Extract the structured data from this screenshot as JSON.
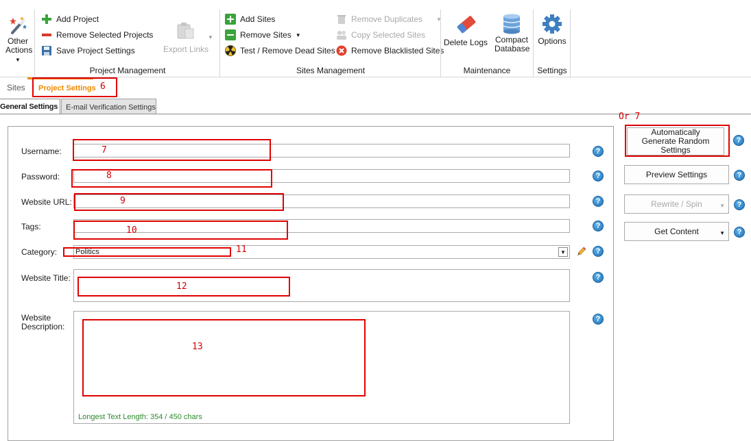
{
  "ribbon": {
    "other_actions": "Other Actions",
    "project_management": {
      "group_label": "Project Management",
      "add_project": "Add Project",
      "remove_selected_projects": "Remove Selected Projects",
      "save_project_settings": "Save Project Settings",
      "export_links": "Export Links"
    },
    "sites_management": {
      "group_label": "Sites Management",
      "add_sites": "Add Sites",
      "remove_sites": "Remove Sites",
      "test_remove_dead_sites": "Test / Remove Dead Sites",
      "remove_duplicates": "Remove Duplicates",
      "copy_selected_sites": "Copy Selected Sites",
      "remove_blacklisted_sites": "Remove Blacklisted Sites"
    },
    "maintenance": {
      "group_label": "Maintenance",
      "delete_logs": "Delete Logs",
      "compact_database": "Compact Database"
    },
    "settings": {
      "group_label": "Settings",
      "options": "Options"
    }
  },
  "tabs": {
    "sites": "Sites",
    "project_settings": "Project Settings"
  },
  "subtabs": {
    "general_settings": "General Settings",
    "email_verification": "E-mail Verification Settings"
  },
  "form": {
    "username_label": "Username:",
    "password_label": "Password:",
    "website_url_label": "Website URL:",
    "tags_label": "Tags:",
    "category_label": "Category:",
    "category_value": "Politics",
    "website_title_label": "Website Title:",
    "website_description_label": "Website Description:",
    "longest_text_length": "Longest Text Length: 354 / 450 chars"
  },
  "side_buttons": {
    "auto_generate": "Automatically Generate Random Settings",
    "preview_settings": "Preview Settings",
    "rewrite_spin": "Rewrite / Spin",
    "get_content": "Get Content"
  },
  "annotations": {
    "a6": "6",
    "a7": "7",
    "a8": "8",
    "a9": "9",
    "a10": "10",
    "a11": "11",
    "a12": "12",
    "a13": "13",
    "or7": "Or 7"
  },
  "icons": {
    "help": "?",
    "dropdown": "▾"
  },
  "colors": {
    "annotation_red": "#e00000",
    "tab_active": "#f08a00",
    "status_green": "#2e8b2e"
  }
}
